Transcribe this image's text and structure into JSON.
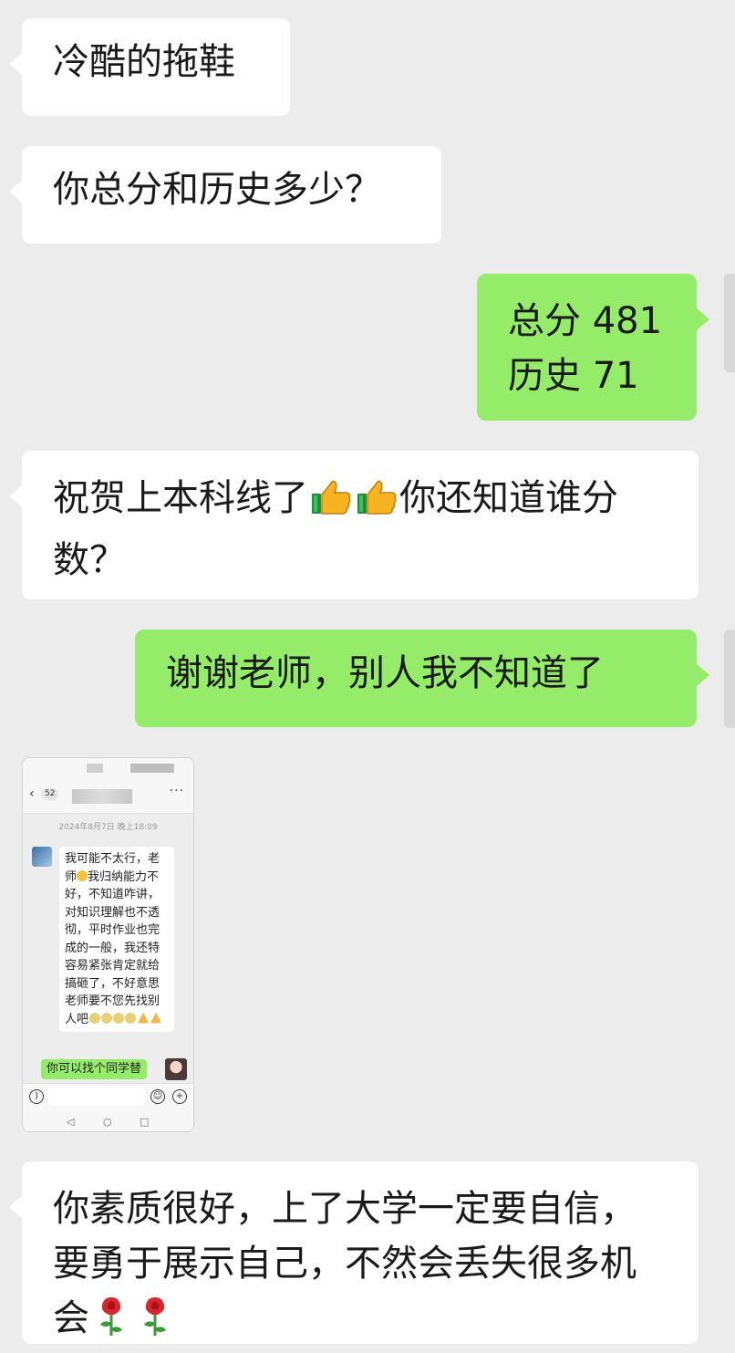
{
  "messages": [
    {
      "sender": "other",
      "text": "冷酷的拖鞋"
    },
    {
      "sender": "other",
      "text": "你总分和历史多少？"
    },
    {
      "sender": "self",
      "lines": [
        "总分 481",
        "历史 71"
      ]
    },
    {
      "sender": "other",
      "text_before": "祝贺上本科线了",
      "text_after": "你还知道谁分数？",
      "emojis": [
        "thumbs-up",
        "thumbs-up"
      ]
    },
    {
      "sender": "self",
      "text": "谢谢老师，别人我不知道了"
    },
    {
      "sender": "other",
      "text": "你素质很好，上了大学一定要自信，要勇于展示自己，不然会丢失很多机会",
      "emojis": [
        "rose",
        "rose"
      ]
    }
  ],
  "screenshot": {
    "badge": "52",
    "more": "···",
    "timestamp": "2024年8月7日 晚上18:09",
    "incoming_before_emoji": "我可能不太行，老师",
    "incoming_after_emoji": "我归纳能力不好，不知道咋讲，对知识理解也不透彻，平时作业也完成的一般，我还特容易紧张肯定就给搞砸了，不好意思老师要不您先找别人吧",
    "outgoing": "你可以找个同学替"
  }
}
